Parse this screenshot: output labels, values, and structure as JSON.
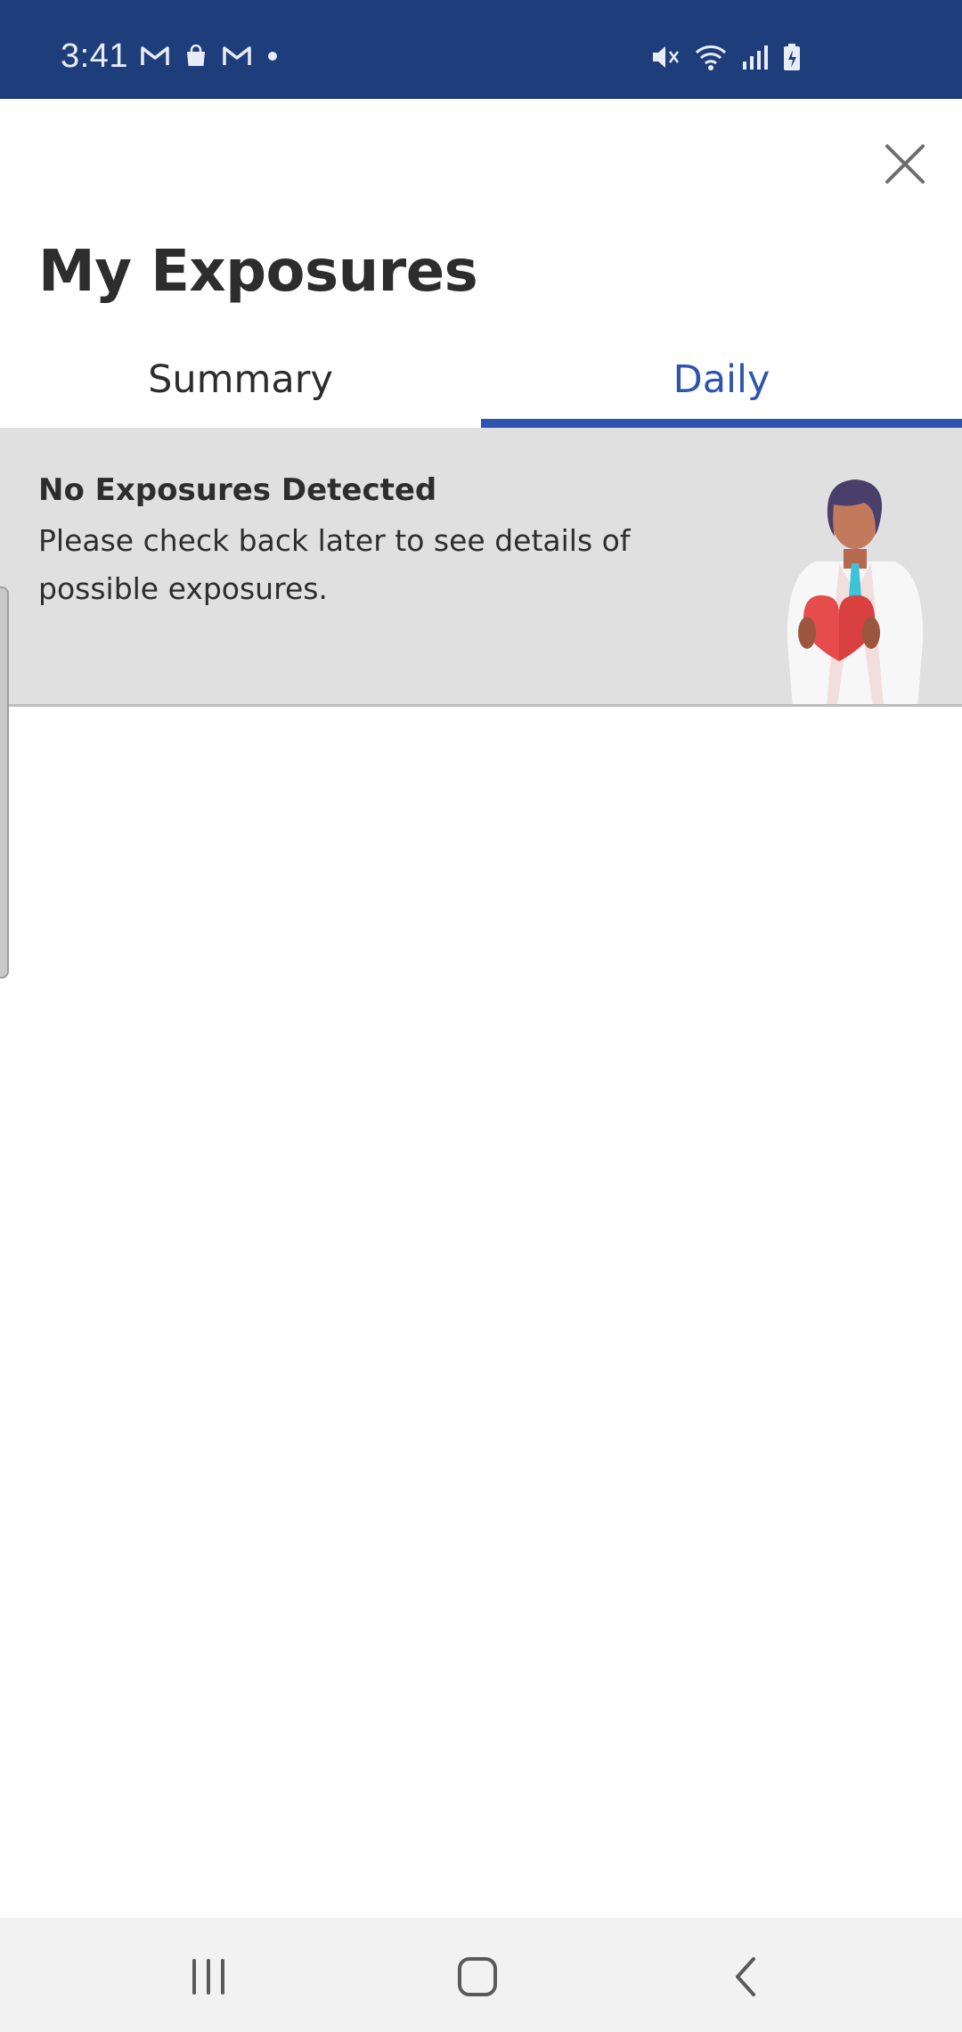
{
  "status_bar": {
    "time": "3:41",
    "left_icons": [
      "gmail-icon",
      "shopping-bag-icon",
      "gmail-icon",
      "notification-dot-icon"
    ],
    "right_icons": [
      "mute-icon",
      "wifi-icon",
      "signal-icon",
      "battery-charging-icon"
    ],
    "background_color": "#1e3e7b"
  },
  "header": {
    "title": "My Exposures",
    "close_icon": "close-icon"
  },
  "tabs": [
    {
      "label": "Summary",
      "active": false
    },
    {
      "label": "Daily",
      "active": true
    }
  ],
  "accent_color": "#2d55b0",
  "notice": {
    "heading": "No Exposures Detected",
    "body": "Please check back later to see details of possible exposures.",
    "illustration": "doctor-holding-heart-illustration"
  },
  "nav_bar": {
    "buttons": [
      "recent-apps-icon",
      "home-icon",
      "back-icon"
    ]
  }
}
